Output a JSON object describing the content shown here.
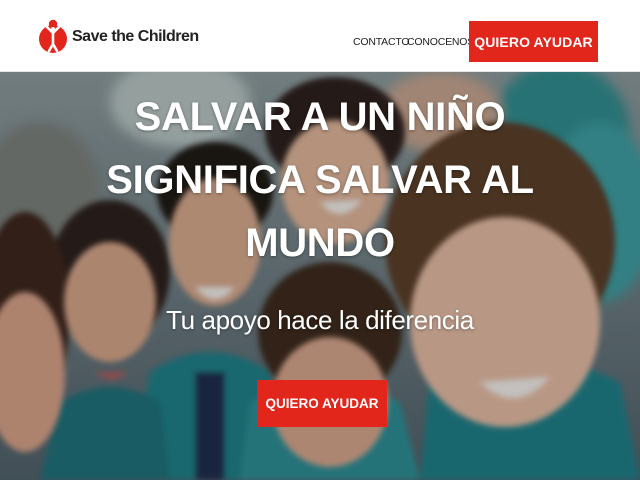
{
  "brand": {
    "name": "Save the Children",
    "logo_icon": "save-the-children-figure-icon",
    "color": "#e3261b"
  },
  "nav": {
    "links": [
      "CONTACTO",
      "CONOCENOS"
    ],
    "cta_label": "QUIERO AYUDAR"
  },
  "hero": {
    "headline": {
      "line1_regular": "SALVAR A UN ",
      "line1_bold": "NIÑO",
      "line2": "SIGNIFICA SALVAR AL",
      "line3_bold": "MUNDO"
    },
    "subline": "Tu apoyo hace la diferencia",
    "cta_label": "QUIERO AYUDAR",
    "background": "photo of smiling children in teal school uniforms"
  },
  "colors": {
    "accent_red": "#e3261b",
    "text_dark": "#222222",
    "text_light": "#ffffff"
  }
}
